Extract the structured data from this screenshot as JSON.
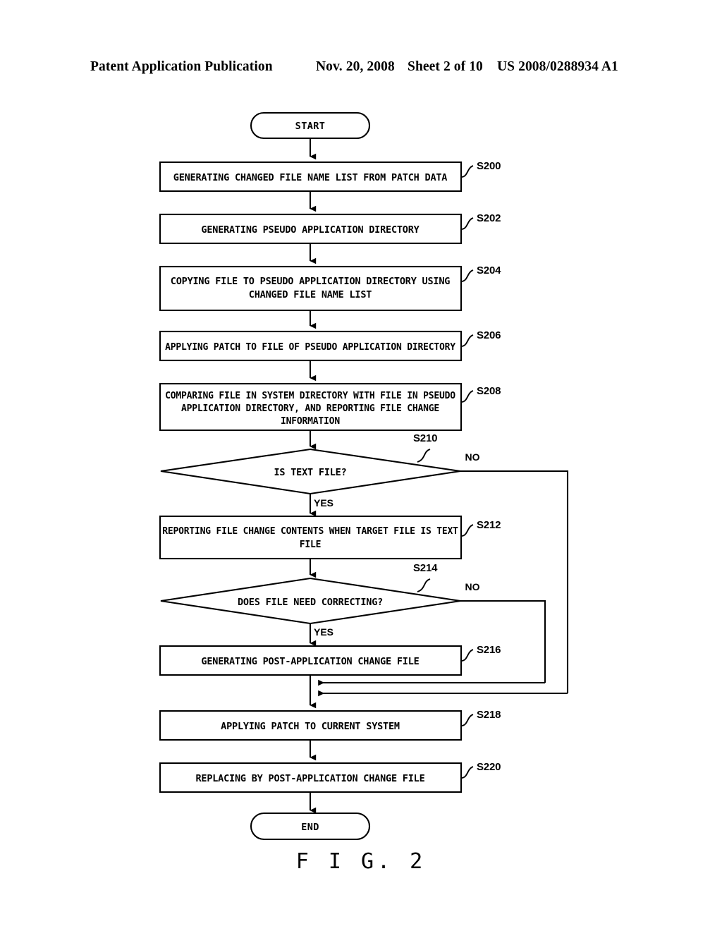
{
  "header": {
    "publication": "Patent Application Publication",
    "date": "Nov. 20, 2008",
    "sheet": "Sheet 2 of 10",
    "patent_number": "US 2008/0288934 A1"
  },
  "figure": {
    "caption": "F I G.  2",
    "start_label": "START",
    "end_label": "END",
    "yes_label": "YES",
    "no_label": "NO",
    "nodes": [
      {
        "id": "start",
        "type": "terminator",
        "label": "START",
        "step": ""
      },
      {
        "id": "s200",
        "type": "process",
        "step": "S200",
        "lines": [
          "GENERATING CHANGED FILE NAME LIST FROM PATCH DATA"
        ]
      },
      {
        "id": "s202",
        "type": "process",
        "step": "S202",
        "lines": [
          "GENERATING PSEUDO APPLICATION DIRECTORY"
        ]
      },
      {
        "id": "s204",
        "type": "process",
        "step": "S204",
        "lines": [
          "COPYING FILE TO PSEUDO APPLICATION DIRECTORY USING",
          "CHANGED FILE NAME LIST"
        ]
      },
      {
        "id": "s206",
        "type": "process",
        "step": "S206",
        "lines": [
          "APPLYING PATCH TO FILE OF PSEUDO APPLICATION DIRECTORY"
        ]
      },
      {
        "id": "s208",
        "type": "process",
        "step": "S208",
        "lines": [
          "COMPARING FILE IN SYSTEM DIRECTORY WITH FILE IN PSEUDO",
          "APPLICATION DIRECTORY, AND REPORTING FILE CHANGE",
          "INFORMATION"
        ]
      },
      {
        "id": "s210",
        "type": "decision",
        "step": "S210",
        "lines": [
          "IS TEXT FILE?"
        ],
        "yes": "YES",
        "no": "NO"
      },
      {
        "id": "s212",
        "type": "process",
        "step": "S212",
        "lines": [
          "REPORTING FILE CHANGE CONTENTS WHEN TARGET FILE IS TEXT",
          "FILE"
        ]
      },
      {
        "id": "s214",
        "type": "decision",
        "step": "S214",
        "lines": [
          "DOES FILE NEED CORRECTING?"
        ],
        "yes": "YES",
        "no": "NO"
      },
      {
        "id": "s216",
        "type": "process",
        "step": "S216",
        "lines": [
          "GENERATING POST-APPLICATION CHANGE FILE"
        ]
      },
      {
        "id": "s218",
        "type": "process",
        "step": "S218",
        "lines": [
          "APPLYING PATCH TO CURRENT SYSTEM"
        ]
      },
      {
        "id": "s220",
        "type": "process",
        "step": "S220",
        "lines": [
          "REPLACING BY POST-APPLICATION CHANGE FILE"
        ]
      },
      {
        "id": "end",
        "type": "terminator",
        "label": "END",
        "step": ""
      }
    ]
  },
  "colors": {
    "ink": "#000000",
    "paper": "#ffffff"
  }
}
